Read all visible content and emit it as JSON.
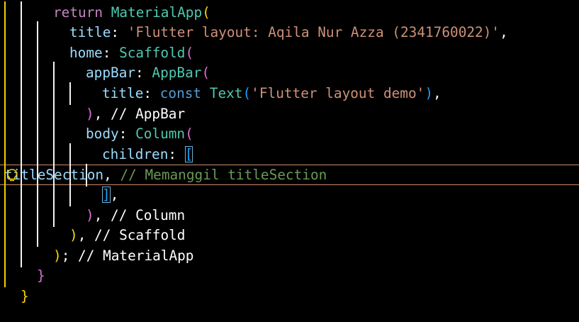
{
  "editor": {
    "current_line_index": 8,
    "lines": [
      {
        "guides": 2,
        "tokens": [
          {
            "t": "return ",
            "c": "#c586c0"
          },
          {
            "t": "MaterialApp",
            "c": "#4ec9b0"
          },
          {
            "t": "(",
            "c": "#ffd700"
          }
        ]
      },
      {
        "guides": 3,
        "tokens": [
          {
            "t": "title",
            "c": "#9cdcfe"
          },
          {
            "t": ": ",
            "c": "#ffffff"
          },
          {
            "t": "'Flutter layout: Aqila Nur Azza (2341760022)'",
            "c": "#ce9178"
          },
          {
            "t": ",",
            "c": "#ffffff"
          }
        ]
      },
      {
        "guides": 3,
        "tokens": [
          {
            "t": "home",
            "c": "#9cdcfe"
          },
          {
            "t": ": ",
            "c": "#ffffff"
          },
          {
            "t": "Scaffold",
            "c": "#4ec9b0"
          },
          {
            "t": "(",
            "c": "#da70d6"
          }
        ]
      },
      {
        "guides": 4,
        "tokens": [
          {
            "t": "appBar",
            "c": "#9cdcfe"
          },
          {
            "t": ": ",
            "c": "#ffffff"
          },
          {
            "t": "AppBar",
            "c": "#4ec9b0"
          },
          {
            "t": "(",
            "c": "#da70d6"
          }
        ]
      },
      {
        "guides": 5,
        "tokens": [
          {
            "t": "title",
            "c": "#9cdcfe"
          },
          {
            "t": ": ",
            "c": "#ffffff"
          },
          {
            "t": "const ",
            "c": "#569cd6"
          },
          {
            "t": "Text",
            "c": "#4ec9b0"
          },
          {
            "t": "(",
            "c": "#179fff"
          },
          {
            "t": "'Flutter layout demo'",
            "c": "#ce9178"
          },
          {
            "t": ")",
            "c": "#179fff"
          },
          {
            "t": ",",
            "c": "#ffffff"
          }
        ]
      },
      {
        "guides": 4,
        "tokens": [
          {
            "t": ")",
            "c": "#da70d6"
          },
          {
            "t": ", ",
            "c": "#ffffff"
          },
          {
            "t": "// AppBar",
            "c": "#ffffff"
          }
        ]
      },
      {
        "guides": 4,
        "tokens": [
          {
            "t": "body",
            "c": "#9cdcfe"
          },
          {
            "t": ": ",
            "c": "#ffffff"
          },
          {
            "t": "Column",
            "c": "#4ec9b0"
          },
          {
            "t": "(",
            "c": "#da70d6"
          }
        ]
      },
      {
        "guides": 5,
        "tokens": [
          {
            "t": "children",
            "c": "#9cdcfe"
          },
          {
            "t": ": ",
            "c": "#ffffff"
          },
          {
            "t": "[",
            "c": "#179fff",
            "box": true
          }
        ]
      },
      {
        "guides": 6,
        "tokens": [
          {
            "t": "titleSection",
            "c": "#9cdcfe"
          },
          {
            "t": ", ",
            "c": "#ffffff"
          },
          {
            "t": "// Memanggil titleSection",
            "c": "#6a9955"
          }
        ]
      },
      {
        "guides": 5,
        "tokens": [
          {
            "t": "]",
            "c": "#179fff",
            "box": true
          },
          {
            "t": ",",
            "c": "#ffffff"
          }
        ]
      },
      {
        "guides": 4,
        "tokens": [
          {
            "t": ")",
            "c": "#da70d6"
          },
          {
            "t": ", ",
            "c": "#ffffff"
          },
          {
            "t": "// Column",
            "c": "#ffffff"
          }
        ]
      },
      {
        "guides": 3,
        "tokens": [
          {
            "t": ")",
            "c": "#ffd700"
          },
          {
            "t": ", ",
            "c": "#ffffff"
          },
          {
            "t": "// Scaffold",
            "c": "#ffffff"
          }
        ]
      },
      {
        "guides": 2,
        "tokens": [
          {
            "t": ")",
            "c": "#ffd700"
          },
          {
            "t": "; ",
            "c": "#ffffff"
          },
          {
            "t": "// MaterialApp",
            "c": "#ffffff"
          }
        ]
      },
      {
        "guides": 1,
        "tokens": [
          {
            "t": "}",
            "c": "#da70d6"
          }
        ]
      },
      {
        "guides": 0,
        "tokens": [
          {
            "t": "}",
            "c": "#ffd700"
          }
        ]
      }
    ],
    "lightbulb_icon": "lightbulb-icon",
    "lightbulb_color": "#f0d000"
  }
}
